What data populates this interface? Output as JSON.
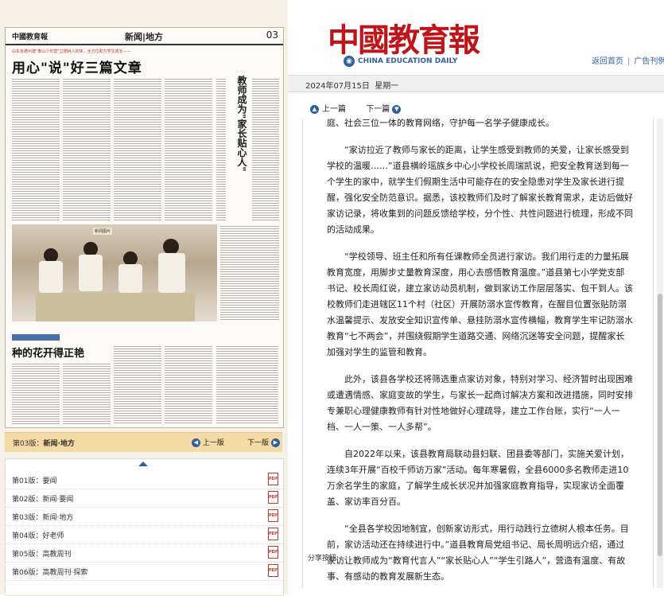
{
  "newspaper": {
    "logo": "中國教育報",
    "section": "新闻|地方",
    "page_number": "03",
    "kicker": "山东省德州建\"泰山少年营\"立德树人初体，全方位助力学生成长——",
    "headline": "用心\"说\"好三篇文章",
    "side_title": "教师成为\"家长贴心人\"",
    "photo_label": "新闻图片",
    "headline2": "种的花开得正艳"
  },
  "pager": {
    "label_prefix": "第03版：",
    "label_name": "新闻·地方",
    "prev": "上一版",
    "next": "下一版"
  },
  "page_list": [
    {
      "label": "第01版：要闻"
    },
    {
      "label": "第02版：新闻·要闻"
    },
    {
      "label": "第03版：新闻·地方"
    },
    {
      "label": "第04版：好老师"
    },
    {
      "label": "第05版：高教周刊"
    },
    {
      "label": "第06版：高教周刊·探索"
    }
  ],
  "header": {
    "brand": "中國教育報",
    "brand_en": "CHINA EDUCATION DAILY",
    "home_link": "返回首页",
    "ad_link": "广告刊例"
  },
  "date_bar": {
    "date": "2024年07月15日",
    "weekday": "星期一"
  },
  "article_nav": {
    "prev": "上一篇",
    "next": "下一篇"
  },
  "article": {
    "paragraphs": [
      "庭、社会三位一体的教育网络，守护每一名学子健康成长。",
      "“家访拉近了教师与家长的距离，让学生感受到教师的关爱，让家长感受到学校的温暖……”道县横岭瑶族乡中心小学校长周瑞凯说，把安全教育送到每一个学生的家中，就学生们假期生活中可能存在的安全隐患对学生及家长进行提醒，强化安全防范意识。据悉，该校教师们及时了解家长教育需求，走访后做好家访记录，将收集到的问题反馈给学校，分个性、共性问题进行梳理，形成不同的活动成果。",
      "“学校领导、班主任和所有任课教师全员进行家访。我们用行走的力量拓展教育宽度，用脚步丈量教育深度，用心去感悟教育温度。”道县第七小学党支部书记、校长周红说，建立家访动员机制，做到家访工作层层落实、包干到人。该校教师们走进辖区11个村（社区）开展防溺水宣传教育，在醒目位置张贴防溺水温馨提示、发放安全知识宣传单、悬挂防溺水宣传横幅，教育学生牢记防溺水教育“七不两会”，并围绕假期学生道路交通、网络沉迷等安全问题，提醒家长加强对学生的监管和教育。",
      "此外，该县各学校还将筛选重点家访对象，特别对学习、经济暂时出现困难或遭遇情感、家庭变故的学生，与家长一起商讨解决方案和改进措施，同时安排专兼职心理健康教师有针对性地做好心理疏导，建立工作台账，实行“一人一档、一人一策、一人多帮”。",
      "自2022年以来，该县教育局联动县妇联、团县委等部门，实施关爱计划，连续3年开展“百校千师访万家”活动。每年寒暑假，全县6000多名教师走进10万余名学生的家庭，了解学生成长状况并加强家庭教育指导，实现家访全面覆盖、家访率百分百。",
      "“全县各学校因地制宜，创新家访形式，用行动践行立德树人根本任务。目前，家访活动还在持续进行中。”道县教育局党组书记、局长周明远介绍，通过家访让教师成为“教育代言人”“家长贴心人”“学生引路人”，营造有温度、有故事、有感动的教育发展新生态。"
    ],
    "share_label": "分享按钮"
  },
  "colors": {
    "brand_red": "#c0141b",
    "link_blue": "#2f5f9e",
    "pager_bg": "#f3d9a3"
  }
}
